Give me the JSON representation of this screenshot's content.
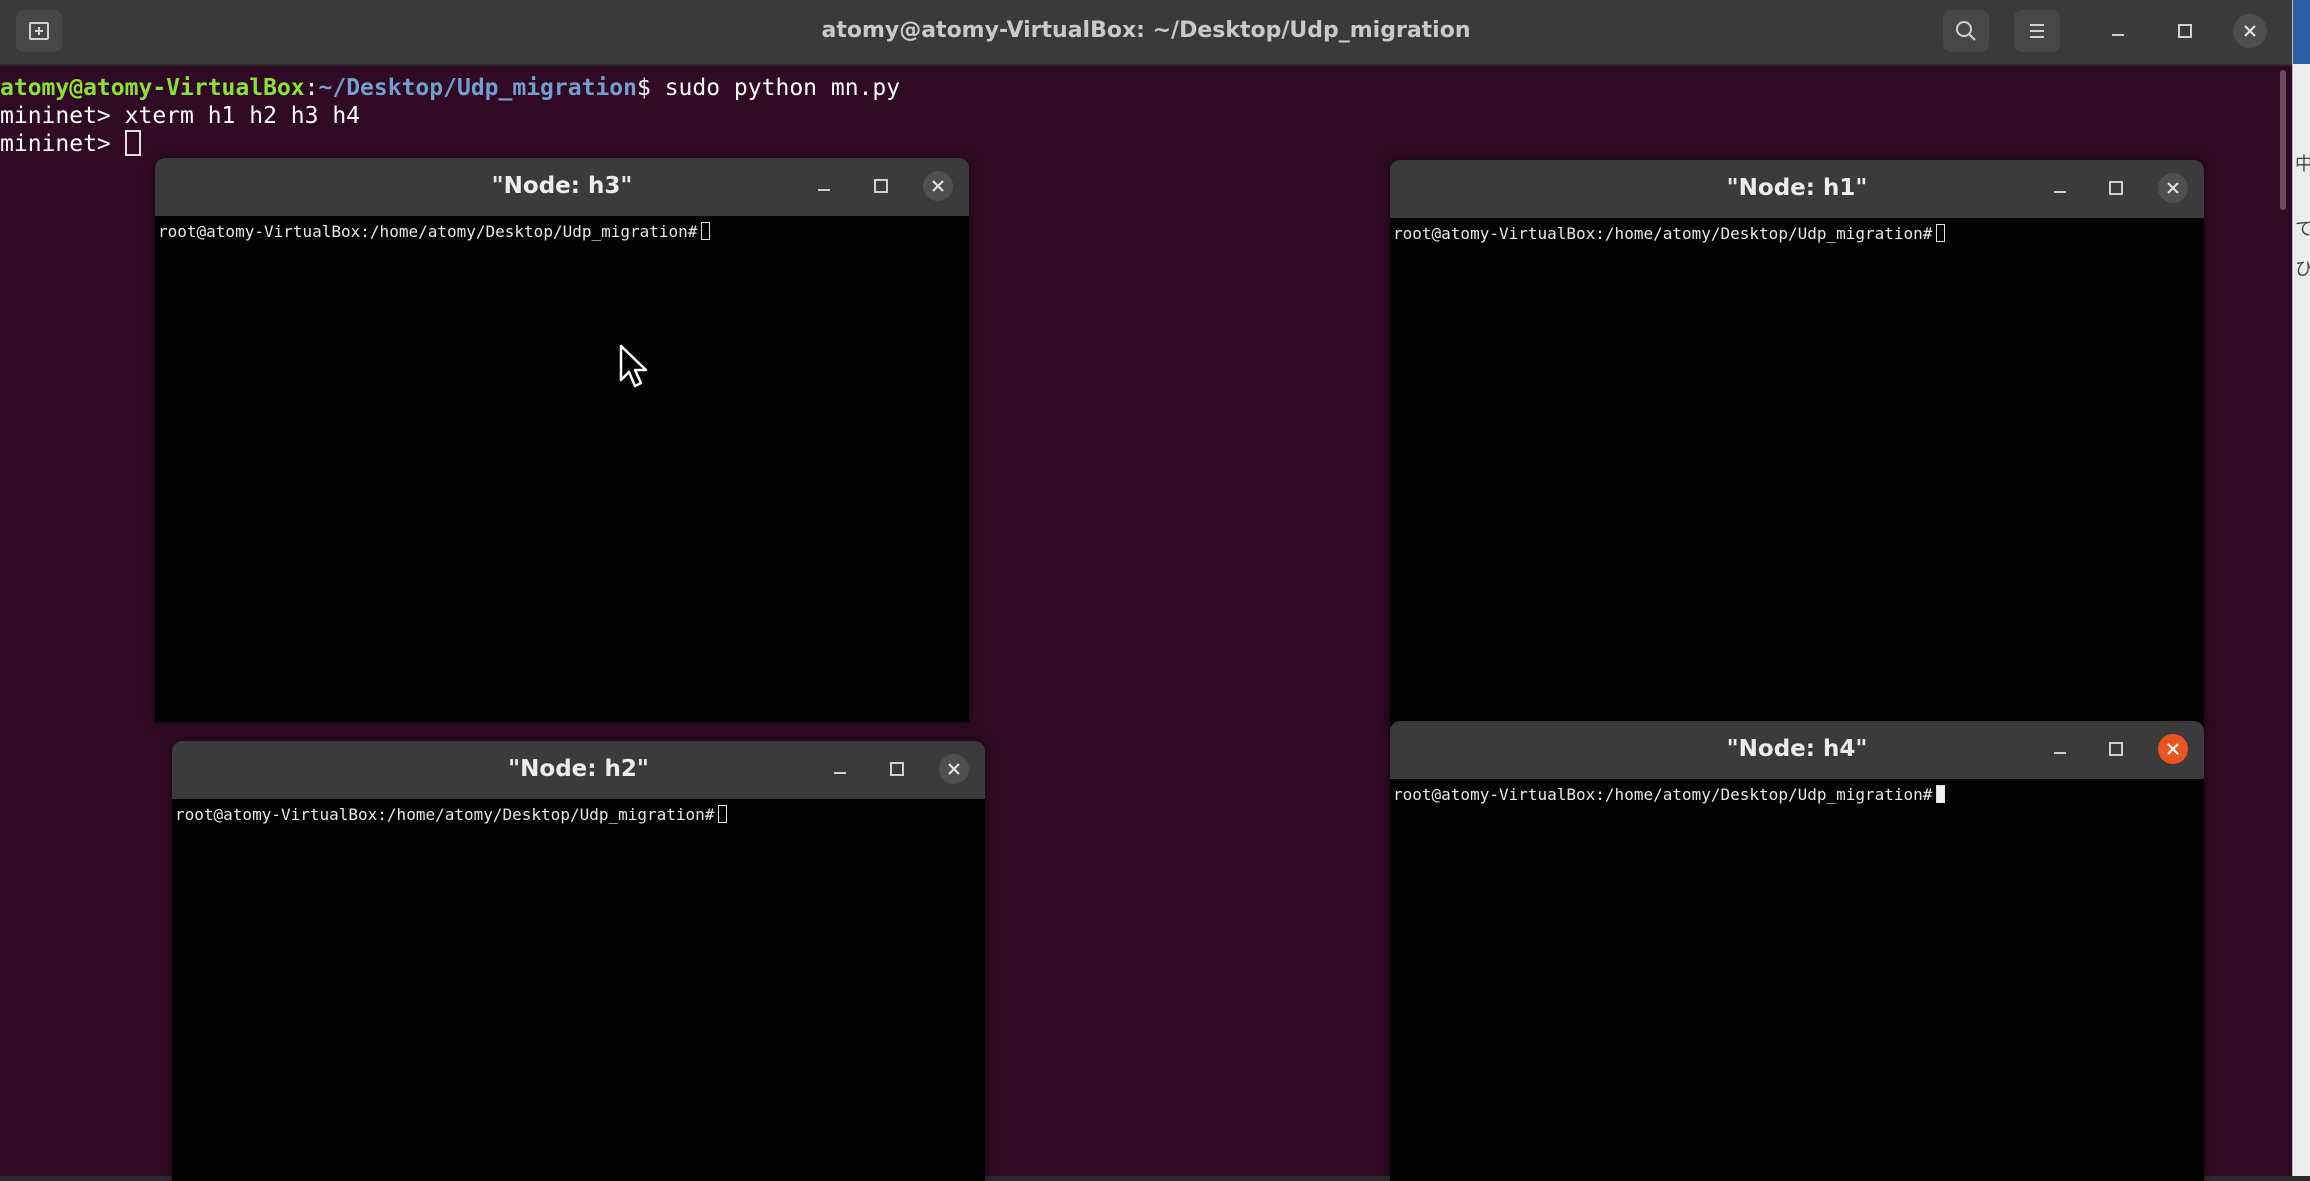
{
  "main_window": {
    "title": "atomy@atomy-VirtualBox: ~/Desktop/Udp_migration",
    "lines": {
      "l1_user": "atomy@atomy-VirtualBox",
      "l1_colon": ":",
      "l1_path": "~/Desktop/Udp_migration",
      "l1_cmd": "$ sudo python mn.py",
      "l2": "mininet> xterm h1 h2 h3 h4",
      "l3": "mininet> "
    },
    "icons": [
      "new-tab-icon",
      "search-icon",
      "hamburger-menu-icon",
      "minimize-icon",
      "maximize-icon",
      "close-icon"
    ]
  },
  "xterms": {
    "h3": {
      "title": "\"Node: h3\"",
      "prompt": "root@atomy-VirtualBox:/home/atomy/Desktop/Udp_migration#"
    },
    "h1": {
      "title": "\"Node: h1\"",
      "prompt": "root@atomy-VirtualBox:/home/atomy/Desktop/Udp_migration#"
    },
    "h2": {
      "title": "\"Node: h2\"",
      "prompt": "root@atomy-VirtualBox:/home/atomy/Desktop/Udp_migration#"
    },
    "h4": {
      "title": "\"Node: h4\"",
      "prompt": "root@atomy-VirtualBox:/home/atomy/Desktop/Udp_migration#",
      "focused": true
    }
  },
  "colors": {
    "terminal_bg": "#300a24",
    "prompt_user": "#8ae234",
    "prompt_path": "#729fcf",
    "active_close": "#e95420"
  },
  "side_window": {
    "glyphs": [
      "中",
      "て",
      "ひ"
    ]
  }
}
